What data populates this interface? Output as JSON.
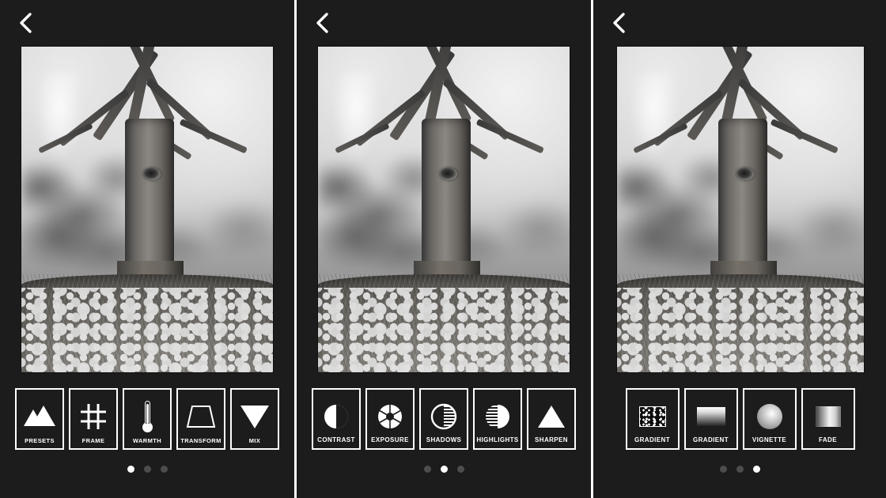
{
  "app": {
    "background_color": "#1c1c1c",
    "accent_color": "#ffffff",
    "photo_alt": "Black and white photograph of a large tree trunk with spreading bare branches, blurred treeline and bright sky behind, grassy field with small white wildflowers in the foreground"
  },
  "panels": [
    {
      "id": "panel-presets",
      "back_label": "Back",
      "back_icon": "chevron-left-icon",
      "tools": [
        {
          "label": "PRESETS",
          "icon": "mountains-icon"
        },
        {
          "label": "FRAME",
          "icon": "grid-hash-icon"
        },
        {
          "label": "WARMTH",
          "icon": "thermometer-icon"
        },
        {
          "label": "TRANSFORM",
          "icon": "trapezoid-icon"
        },
        {
          "label": "MIX",
          "icon": "triangle-down-icon"
        }
      ],
      "pagination": {
        "total": 3,
        "active": 1
      }
    },
    {
      "id": "panel-tone",
      "back_label": "Back",
      "back_icon": "chevron-left-icon",
      "tools": [
        {
          "label": "CONTRAST",
          "icon": "half-circle-icon"
        },
        {
          "label": "EXPOSURE",
          "icon": "aperture-icon"
        },
        {
          "label": "SHADOWS",
          "icon": "shadows-circle-icon"
        },
        {
          "label": "HIGHLIGHTS",
          "icon": "highlights-circle-icon"
        },
        {
          "label": "SHARPEN",
          "icon": "triangle-up-icon"
        }
      ],
      "pagination": {
        "total": 3,
        "active": 2
      }
    },
    {
      "id": "panel-effects",
      "back_label": "Back",
      "back_icon": "chevron-left-icon",
      "tools": [
        {
          "label": "GRADIENT",
          "icon": "grain-icon"
        },
        {
          "label": "GRADIENT",
          "icon": "linear-gradient-icon"
        },
        {
          "label": "VIGNETTE",
          "icon": "sphere-icon"
        },
        {
          "label": "FADE",
          "icon": "fade-icon"
        }
      ],
      "pagination": {
        "total": 3,
        "active": 3
      }
    }
  ]
}
